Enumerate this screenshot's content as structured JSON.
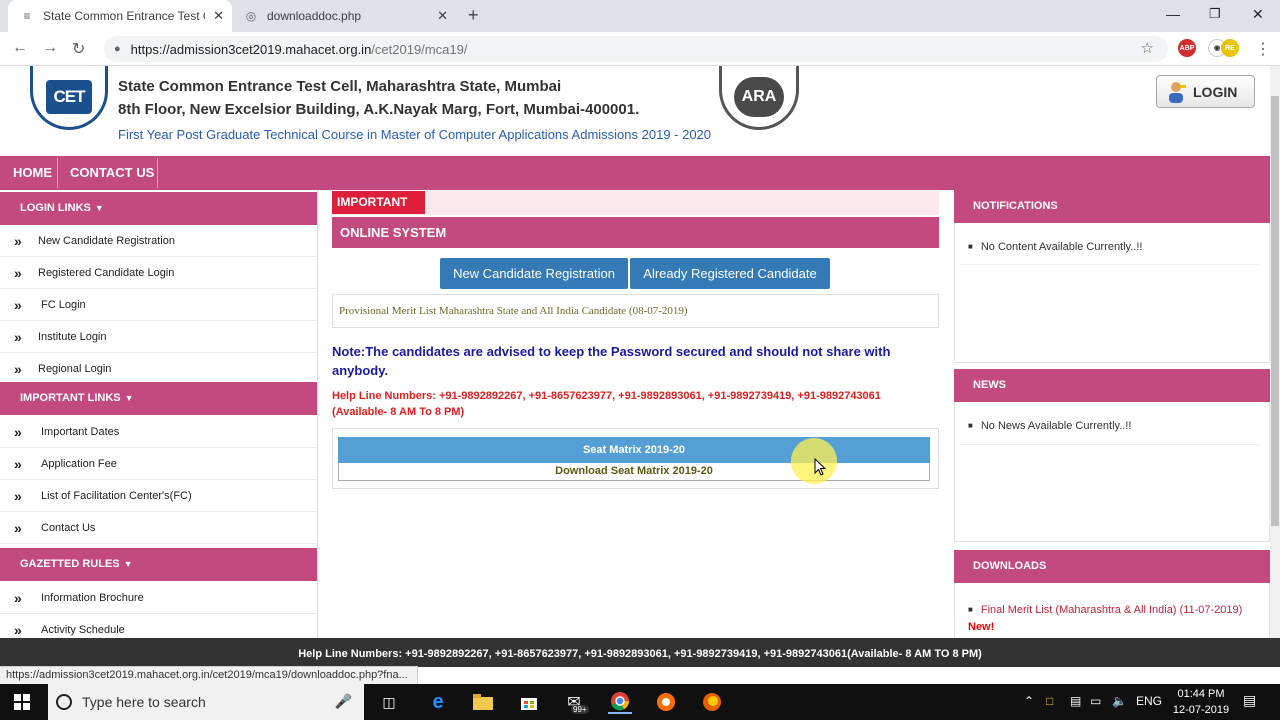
{
  "browser": {
    "tabs": [
      {
        "title": "State Common Entrance Test Cell",
        "active": true
      },
      {
        "title": "downloaddoc.php",
        "active": false
      }
    ],
    "url_host": "https://admission3cet2019.mahacet.org.in",
    "url_path": "/cet2019/mca19/",
    "extensions": [
      "ABP",
      "RE"
    ],
    "status_url": "https://admission3cet2019.mahacet.org.in/cet2019/mca19/downloaddoc.php?fna..."
  },
  "header": {
    "org_line1": "State Common Entrance Test Cell, Maharashtra State, Mumbai",
    "org_line2": "8th Floor, New Excelsior Building, A.K.Nayak Marg, Fort, Mumbai-400001.",
    "subtitle": "First Year Post Graduate Technical Course in Master of Computer Applications Admissions 2019 - 2020",
    "cet_logo_text": "CET",
    "ara_logo_text": "ARA",
    "login_label": "LOGIN"
  },
  "nav": {
    "home": "HOME",
    "contact": "CONTACT US"
  },
  "left": {
    "login_links": {
      "title": "LOGIN LINKS",
      "items": [
        "New Candidate Registration",
        "Registered Candidate Login",
        "FC Login",
        "Institute Login",
        "Regional Login"
      ]
    },
    "important_links": {
      "title": "IMPORTANT LINKS",
      "items": [
        "Important Dates",
        "Application Fee",
        "List of Facilitation Center's(FC)",
        "Contact Us"
      ]
    },
    "gazetted_rules": {
      "title": "GAZETTED RULES",
      "items": [
        "Information Brochure",
        "Activity Schedule"
      ]
    }
  },
  "center": {
    "important_badge": "IMPORTANT",
    "online_system": "ONLINE SYSTEM",
    "btn_new": "New Candidate Registration",
    "btn_already": "Already Registered Candidate",
    "merit_list": "Provisional Merit List Maharashtra State and All India Candidate (08-07-2019)",
    "note": "Note:The candidates are advised to keep the Password secured and should not share with anybody.",
    "helpline": "Help Line Numbers: +91-9892892267, +91-8657623977, +91-9892893061, +91-9892739419, +91-9892743061 (Available- 8 AM To 8 PM)",
    "seat_matrix_title": "Seat Matrix 2019-20",
    "seat_matrix_link": "Download Seat Matrix 2019-20"
  },
  "right": {
    "notifications": {
      "title": "NOTIFICATIONS",
      "item": "No Content Available Currently..!!"
    },
    "news": {
      "title": "NEWS",
      "item": "No News Available Currently..!!"
    },
    "downloads": {
      "title": "DOWNLOADS",
      "item": "Final Merit List (Maharashtra & All India) (11-07-2019)",
      "new_tag": "New!"
    }
  },
  "bottom_help": "Help Line Numbers: +91-9892892267, +91-8657623977, +91-9892893061, +91-9892739419, +91-9892743061(Available- 8 AM TO 8 PM)",
  "taskbar": {
    "search_placeholder": "Type here to search",
    "badge": "99+",
    "lang": "ENG",
    "time": "01:44 PM",
    "date": "12-07-2019"
  },
  "colors": {
    "brand_pink": "#c24a7e",
    "button_blue": "#337ab7",
    "important_red": "#e0203a"
  }
}
